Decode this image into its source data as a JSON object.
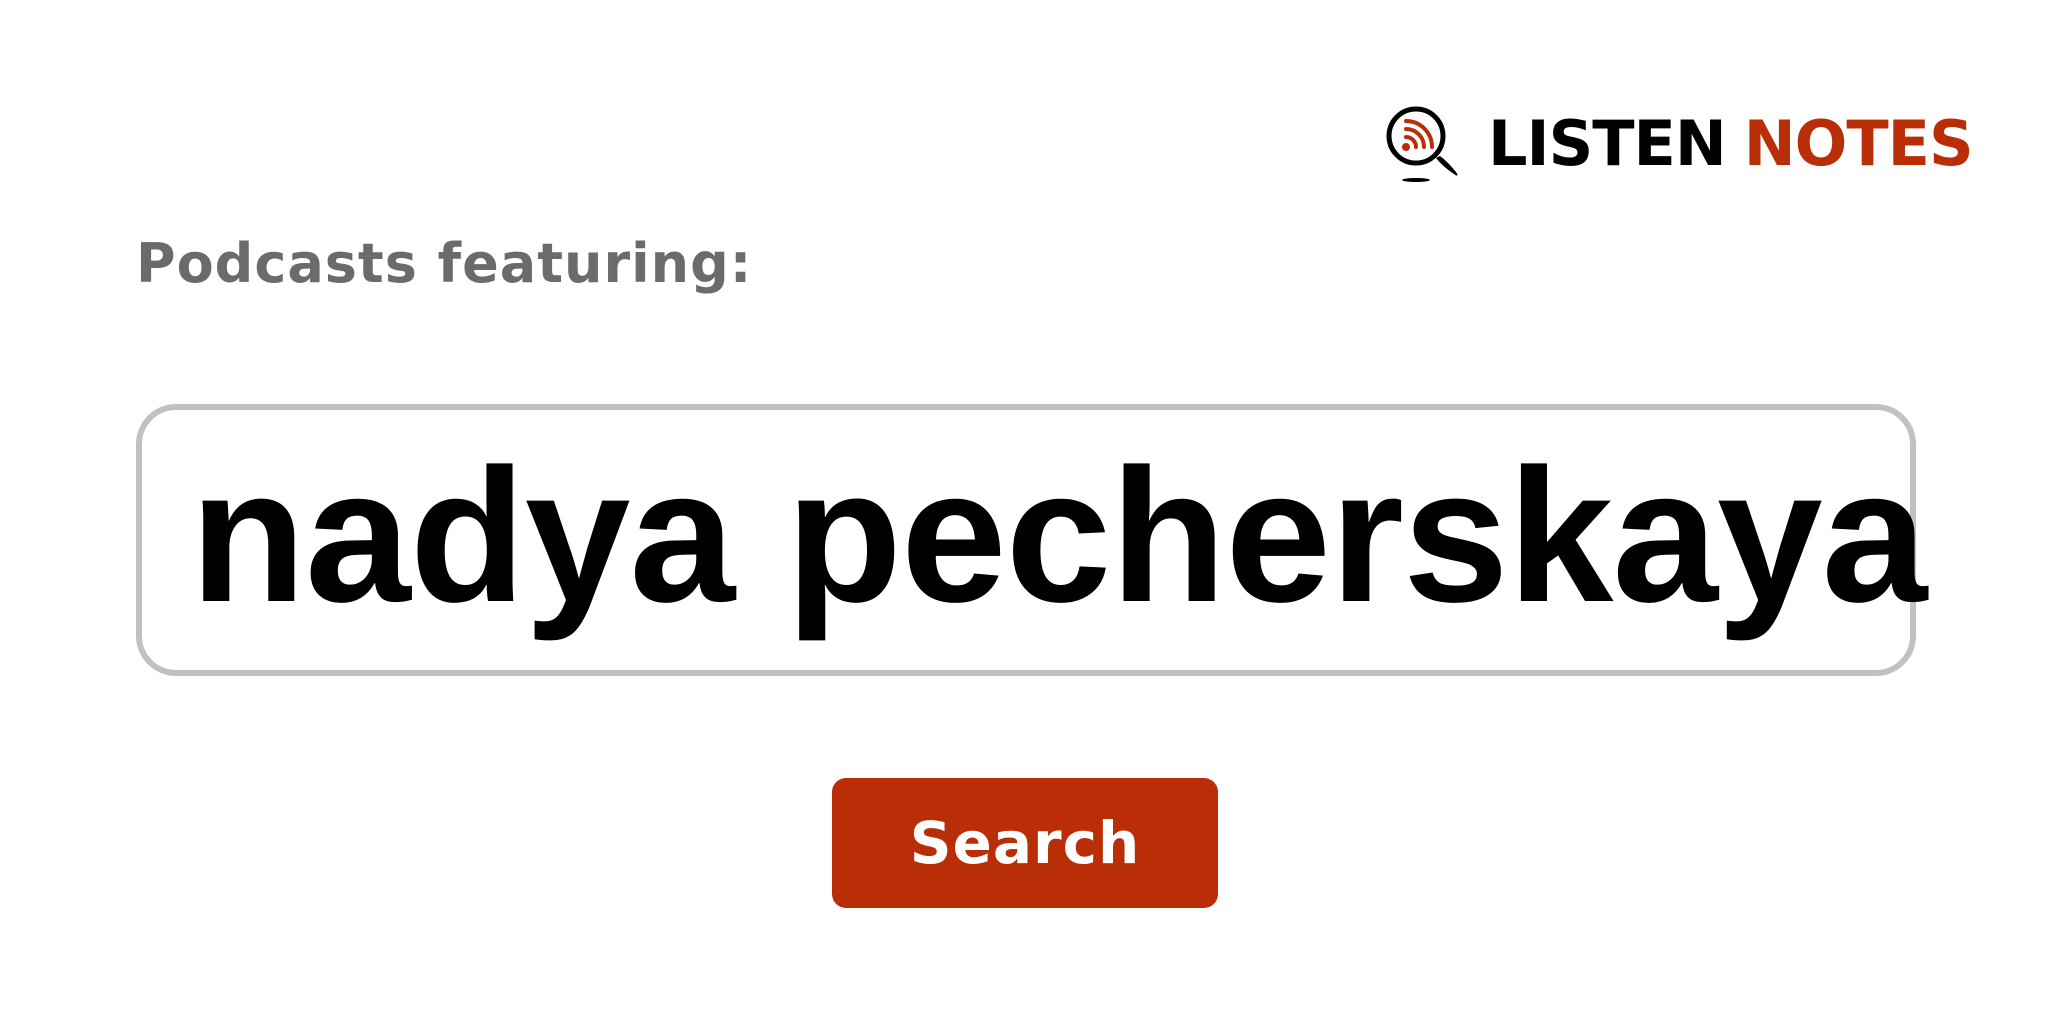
{
  "brand": {
    "word_1": "LISTEN",
    "word_2": "NOTES",
    "icon": "magnifier-rss-icon",
    "colors": {
      "primary": "#b92d07",
      "dark": "#000000"
    }
  },
  "prompt": {
    "label": "Podcasts featuring:"
  },
  "search": {
    "query": "nadya pecherskaya",
    "button_label": "Search"
  },
  "colors": {
    "label_gray": "#6b6b6b",
    "border_gray": "#c1c1c1",
    "button_bg": "#b92d07",
    "button_text": "#ffffff"
  }
}
